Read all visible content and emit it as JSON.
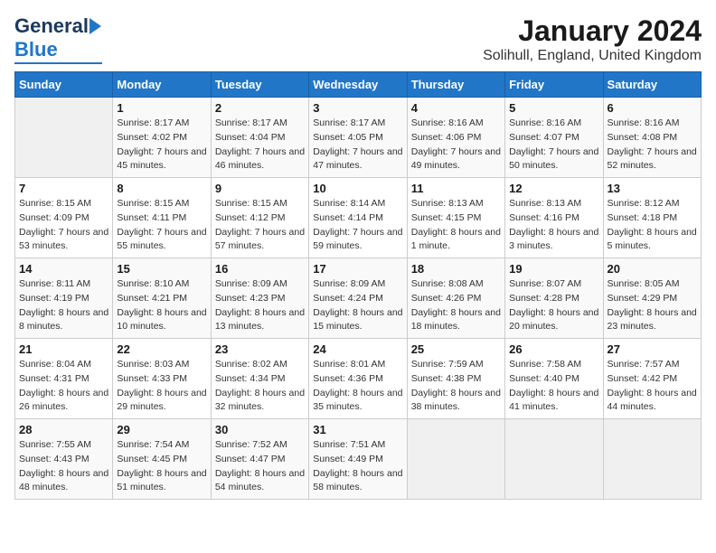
{
  "header": {
    "logo_general": "General",
    "logo_blue": "Blue",
    "title": "January 2024",
    "subtitle": "Solihull, England, United Kingdom"
  },
  "calendar": {
    "weekdays": [
      "Sunday",
      "Monday",
      "Tuesday",
      "Wednesday",
      "Thursday",
      "Friday",
      "Saturday"
    ],
    "weeks": [
      [
        {
          "day": "",
          "sunrise": "",
          "sunset": "",
          "daylight": ""
        },
        {
          "day": "1",
          "sunrise": "Sunrise: 8:17 AM",
          "sunset": "Sunset: 4:02 PM",
          "daylight": "Daylight: 7 hours and 45 minutes."
        },
        {
          "day": "2",
          "sunrise": "Sunrise: 8:17 AM",
          "sunset": "Sunset: 4:04 PM",
          "daylight": "Daylight: 7 hours and 46 minutes."
        },
        {
          "day": "3",
          "sunrise": "Sunrise: 8:17 AM",
          "sunset": "Sunset: 4:05 PM",
          "daylight": "Daylight: 7 hours and 47 minutes."
        },
        {
          "day": "4",
          "sunrise": "Sunrise: 8:16 AM",
          "sunset": "Sunset: 4:06 PM",
          "daylight": "Daylight: 7 hours and 49 minutes."
        },
        {
          "day": "5",
          "sunrise": "Sunrise: 8:16 AM",
          "sunset": "Sunset: 4:07 PM",
          "daylight": "Daylight: 7 hours and 50 minutes."
        },
        {
          "day": "6",
          "sunrise": "Sunrise: 8:16 AM",
          "sunset": "Sunset: 4:08 PM",
          "daylight": "Daylight: 7 hours and 52 minutes."
        }
      ],
      [
        {
          "day": "7",
          "sunrise": "Sunrise: 8:15 AM",
          "sunset": "Sunset: 4:09 PM",
          "daylight": "Daylight: 7 hours and 53 minutes."
        },
        {
          "day": "8",
          "sunrise": "Sunrise: 8:15 AM",
          "sunset": "Sunset: 4:11 PM",
          "daylight": "Daylight: 7 hours and 55 minutes."
        },
        {
          "day": "9",
          "sunrise": "Sunrise: 8:15 AM",
          "sunset": "Sunset: 4:12 PM",
          "daylight": "Daylight: 7 hours and 57 minutes."
        },
        {
          "day": "10",
          "sunrise": "Sunrise: 8:14 AM",
          "sunset": "Sunset: 4:14 PM",
          "daylight": "Daylight: 7 hours and 59 minutes."
        },
        {
          "day": "11",
          "sunrise": "Sunrise: 8:13 AM",
          "sunset": "Sunset: 4:15 PM",
          "daylight": "Daylight: 8 hours and 1 minute."
        },
        {
          "day": "12",
          "sunrise": "Sunrise: 8:13 AM",
          "sunset": "Sunset: 4:16 PM",
          "daylight": "Daylight: 8 hours and 3 minutes."
        },
        {
          "day": "13",
          "sunrise": "Sunrise: 8:12 AM",
          "sunset": "Sunset: 4:18 PM",
          "daylight": "Daylight: 8 hours and 5 minutes."
        }
      ],
      [
        {
          "day": "14",
          "sunrise": "Sunrise: 8:11 AM",
          "sunset": "Sunset: 4:19 PM",
          "daylight": "Daylight: 8 hours and 8 minutes."
        },
        {
          "day": "15",
          "sunrise": "Sunrise: 8:10 AM",
          "sunset": "Sunset: 4:21 PM",
          "daylight": "Daylight: 8 hours and 10 minutes."
        },
        {
          "day": "16",
          "sunrise": "Sunrise: 8:09 AM",
          "sunset": "Sunset: 4:23 PM",
          "daylight": "Daylight: 8 hours and 13 minutes."
        },
        {
          "day": "17",
          "sunrise": "Sunrise: 8:09 AM",
          "sunset": "Sunset: 4:24 PM",
          "daylight": "Daylight: 8 hours and 15 minutes."
        },
        {
          "day": "18",
          "sunrise": "Sunrise: 8:08 AM",
          "sunset": "Sunset: 4:26 PM",
          "daylight": "Daylight: 8 hours and 18 minutes."
        },
        {
          "day": "19",
          "sunrise": "Sunrise: 8:07 AM",
          "sunset": "Sunset: 4:28 PM",
          "daylight": "Daylight: 8 hours and 20 minutes."
        },
        {
          "day": "20",
          "sunrise": "Sunrise: 8:05 AM",
          "sunset": "Sunset: 4:29 PM",
          "daylight": "Daylight: 8 hours and 23 minutes."
        }
      ],
      [
        {
          "day": "21",
          "sunrise": "Sunrise: 8:04 AM",
          "sunset": "Sunset: 4:31 PM",
          "daylight": "Daylight: 8 hours and 26 minutes."
        },
        {
          "day": "22",
          "sunrise": "Sunrise: 8:03 AM",
          "sunset": "Sunset: 4:33 PM",
          "daylight": "Daylight: 8 hours and 29 minutes."
        },
        {
          "day": "23",
          "sunrise": "Sunrise: 8:02 AM",
          "sunset": "Sunset: 4:34 PM",
          "daylight": "Daylight: 8 hours and 32 minutes."
        },
        {
          "day": "24",
          "sunrise": "Sunrise: 8:01 AM",
          "sunset": "Sunset: 4:36 PM",
          "daylight": "Daylight: 8 hours and 35 minutes."
        },
        {
          "day": "25",
          "sunrise": "Sunrise: 7:59 AM",
          "sunset": "Sunset: 4:38 PM",
          "daylight": "Daylight: 8 hours and 38 minutes."
        },
        {
          "day": "26",
          "sunrise": "Sunrise: 7:58 AM",
          "sunset": "Sunset: 4:40 PM",
          "daylight": "Daylight: 8 hours and 41 minutes."
        },
        {
          "day": "27",
          "sunrise": "Sunrise: 7:57 AM",
          "sunset": "Sunset: 4:42 PM",
          "daylight": "Daylight: 8 hours and 44 minutes."
        }
      ],
      [
        {
          "day": "28",
          "sunrise": "Sunrise: 7:55 AM",
          "sunset": "Sunset: 4:43 PM",
          "daylight": "Daylight: 8 hours and 48 minutes."
        },
        {
          "day": "29",
          "sunrise": "Sunrise: 7:54 AM",
          "sunset": "Sunset: 4:45 PM",
          "daylight": "Daylight: 8 hours and 51 minutes."
        },
        {
          "day": "30",
          "sunrise": "Sunrise: 7:52 AM",
          "sunset": "Sunset: 4:47 PM",
          "daylight": "Daylight: 8 hours and 54 minutes."
        },
        {
          "day": "31",
          "sunrise": "Sunrise: 7:51 AM",
          "sunset": "Sunset: 4:49 PM",
          "daylight": "Daylight: 8 hours and 58 minutes."
        },
        {
          "day": "",
          "sunrise": "",
          "sunset": "",
          "daylight": ""
        },
        {
          "day": "",
          "sunrise": "",
          "sunset": "",
          "daylight": ""
        },
        {
          "day": "",
          "sunrise": "",
          "sunset": "",
          "daylight": ""
        }
      ]
    ]
  }
}
